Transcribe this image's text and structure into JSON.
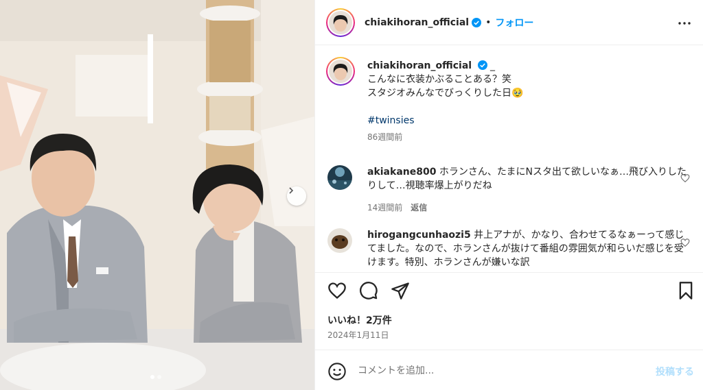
{
  "post": {
    "username": "chiakihoran_official",
    "follow_label": "フォロー",
    "separator": "•",
    "caption_suffix": "_",
    "caption_lines": [
      "こんなに衣装かぶることある？笑",
      "スタジオみんなでびっくりした日"
    ],
    "caption_emoji": "🥹",
    "hashtag": "#twinsies",
    "caption_time": "86週間前",
    "likes_label": "いいね！2万件",
    "date": "2024年1月11日"
  },
  "comments": [
    {
      "username": "akiakane800",
      "text": "ホランさん、たまにNスタ出て欲しいなぁ…飛び入りしたりして…視聴率爆上がりだね",
      "time": "14週間前",
      "reply_label": "返信"
    },
    {
      "username": "hirogangcunhaozi5",
      "text": "井上アナが、かなり、合わせてるなぁーって感じてました。なので、ホランさんが抜けて番組の雰囲気が和らいだ感じを受けます。特別、ホランさんが嫌いな訳",
      "time": "",
      "reply_label": ""
    }
  ],
  "composer": {
    "placeholder": "コメントを追加...",
    "post_label": "投稿する"
  },
  "carousel": {
    "total": 2,
    "active": 1
  },
  "icons": {
    "verified": "verified-badge-icon",
    "more": "more-options-icon",
    "like": "heart-icon",
    "comment": "comment-icon",
    "share": "share-icon",
    "save": "bookmark-icon",
    "emoji": "emoji-icon",
    "next": "chevron-right-icon"
  },
  "colors": {
    "link": "#0095f6",
    "hashtag": "#00376b",
    "muted": "#737373",
    "post_disabled": "#b2dffc"
  }
}
